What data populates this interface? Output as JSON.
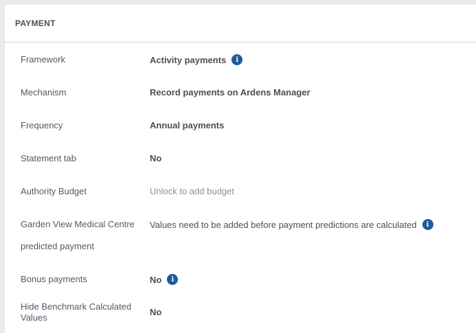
{
  "card": {
    "title": "PAYMENT"
  },
  "rows": [
    {
      "label": "Framework",
      "value": "Activity payments"
    },
    {
      "label": "Mechanism",
      "value": "Record payments on Ardens Manager"
    },
    {
      "label": "Frequency",
      "value": "Annual payments"
    },
    {
      "label": "Statement tab",
      "value": "No"
    },
    {
      "label": "Authority Budget",
      "value": "Unlock to add budget"
    },
    {
      "label_line1": "Garden View Medical Centre",
      "label_line2": "predicted payment",
      "value": "Values need to be added before payment predictions are calculated"
    },
    {
      "label": "Bonus payments",
      "value": "No"
    },
    {
      "label_line1": "Hide Benchmark Calculated",
      "label_line2": "Values",
      "value": "No"
    }
  ],
  "icons": {
    "info": "info-icon"
  },
  "colors": {
    "info_icon_bg": "#1e5a9c",
    "header_divider": "#d5d9de"
  }
}
